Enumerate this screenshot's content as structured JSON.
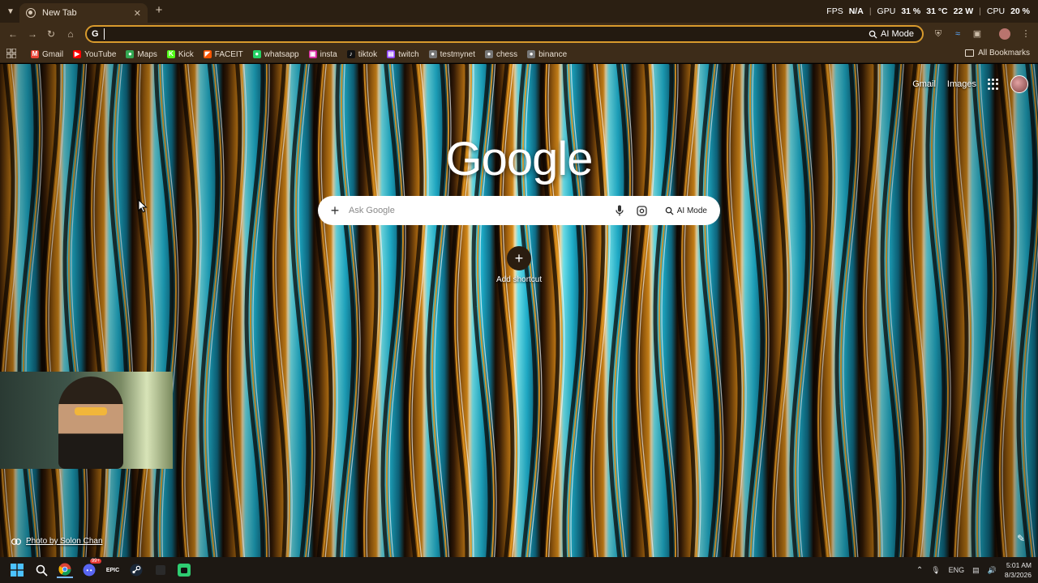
{
  "window": {
    "tab_title": "New Tab",
    "overlay": {
      "fps_label": "FPS",
      "fps_value": "N/A",
      "gpu_label": "GPU",
      "gpu_value": "31 %",
      "gpu_temp": "31 °C",
      "gpu_power": "22 W",
      "cpu_label": "CPU",
      "cpu_value": "20 %"
    }
  },
  "toolbar": {
    "omnibox_value": "",
    "ai_mode_label": "AI Mode"
  },
  "bookmarks": {
    "items": [
      {
        "label": "Gmail",
        "color": "#ea4335",
        "glyph": "M"
      },
      {
        "label": "YouTube",
        "color": "#ff0000",
        "glyph": "▶"
      },
      {
        "label": "Maps",
        "color": "#34a853",
        "glyph": "●"
      },
      {
        "label": "Kick",
        "color": "#53fc18",
        "glyph": "K"
      },
      {
        "label": "FACEIT",
        "color": "#ff5500",
        "glyph": "◤"
      },
      {
        "label": "whatsapp",
        "color": "#25d366",
        "glyph": "●"
      },
      {
        "label": "insta",
        "color": "#d6249f",
        "glyph": "▣"
      },
      {
        "label": "tiktok",
        "color": "#111111",
        "glyph": "♪"
      },
      {
        "label": "twitch",
        "color": "#9146ff",
        "glyph": "▤"
      },
      {
        "label": "testmynet",
        "color": "#777777",
        "glyph": "●"
      },
      {
        "label": "chess",
        "color": "#777777",
        "glyph": "●"
      },
      {
        "label": "binance",
        "color": "#777777",
        "glyph": "●"
      }
    ],
    "all_bookmarks_label": "All Bookmarks"
  },
  "page": {
    "top_links": {
      "gmail": "Gmail",
      "images": "Images"
    },
    "logo": "Google",
    "search": {
      "placeholder": "Ask Google",
      "ai_mode_label": "AI Mode"
    },
    "shortcut_label": "Add shortcut",
    "photo_credit": "Photo by Solon Chan"
  },
  "taskbar": {
    "language": "ENG",
    "time": "5:01 AM",
    "date": "8/3/2026",
    "discord_badge": "99+"
  }
}
